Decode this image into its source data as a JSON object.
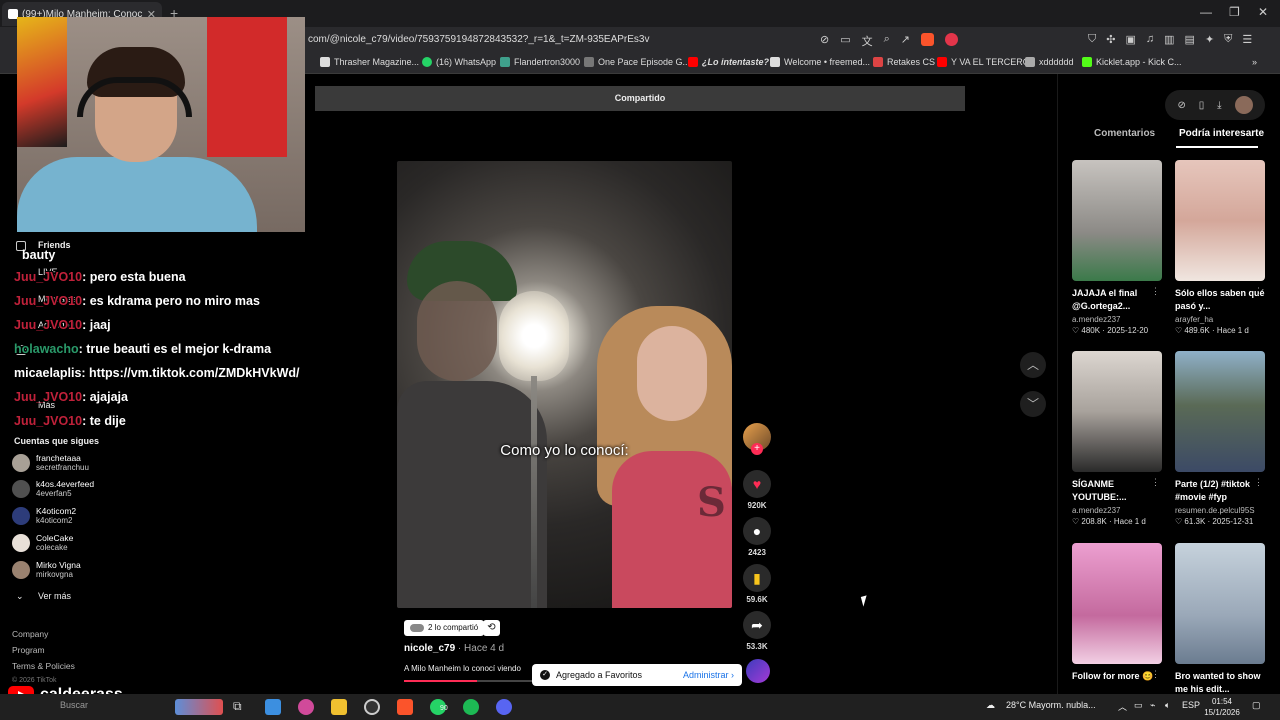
{
  "browser": {
    "tab_title": "(99+)Milo Manheim: Conoci",
    "url": "com/@nicole_c79/video/7593759194872843532?_r=1&_t=ZM-935EAPrEs3v",
    "bookmarks": [
      "Thrasher Magazine...",
      "(16) WhatsApp",
      "Flandertron3000",
      "One Pace Episode G...",
      "¿Lo intentaste?",
      "Welcome • freemed...",
      "Retakes CS",
      "Y VA EL TERCERO",
      "xdddddd",
      "Kicklet.app - Kick C..."
    ]
  },
  "tiktok": {
    "shared_banner": "Compartido",
    "video_caption": "Como yo lo conocí:",
    "actions": {
      "likes": "920K",
      "comments": "2423",
      "saves": "59.6K",
      "shares": "53.3K"
    },
    "shared_pill": "2 lo compartió",
    "creator": "nicole_c79",
    "posted": " · Hace 4 d",
    "description": "A Milo Manheim lo conocí viendo",
    "toast": {
      "text": "Agregado a Favoritos",
      "action": "Administrar"
    },
    "progress": 0.22,
    "side_tabs": [
      "Comentarios",
      "Podría interesarte"
    ],
    "cards": [
      {
        "title": "JAJAJA el final @G.ortega2...",
        "user": "a.mendez237",
        "meta": "♡ 480K · 2025-12-20"
      },
      {
        "title": "Sólo ellos saben qué pasó y...",
        "user": "arayfer_ha",
        "meta": "♡ 489.6K · Hace 1 d"
      },
      {
        "title": "SÍGANME YOUTUBE:...",
        "user": "a.mendez237",
        "meta": "♡ 208.8K · Hace 1 d"
      },
      {
        "title": "Parte (1/2) #tiktok #movie #fyp",
        "user": "resumen.de.pelcul95S",
        "meta": "♡ 61.3K · 2025-12-31"
      },
      {
        "title": "Follow for more 😊",
        "user": "",
        "meta": ""
      },
      {
        "title": "Bro wanted to show me his edit...",
        "user": "",
        "meta": ""
      }
    ]
  },
  "sidebar": {
    "friends": "Friends",
    "live": "LIVE",
    "messages": "Mensajes",
    "activity": "Actividad",
    "more": "Más",
    "following_title": "Cuentas que sigues",
    "following": [
      {
        "name": "franchetaaa",
        "handle": "secretfranchuu"
      },
      {
        "name": "k4os.4everfeed",
        "handle": "4everfan5"
      },
      {
        "name": "K4oticom2",
        "handle": "k4oticom2"
      },
      {
        "name": "ColeCake",
        "handle": "colecake"
      },
      {
        "name": "Mirko Vigna",
        "handle": "mirkovgna"
      }
    ],
    "see_more": "Ver más",
    "footer": [
      "Company",
      "Program",
      "Terms & Policies",
      "© 2026 TikTok"
    ]
  },
  "chat": {
    "header": "bauty",
    "messages": [
      {
        "user": "Juu_JVO10",
        "text": ": pero esta buena"
      },
      {
        "user": "Juu_JVO10",
        "text": ": es kdrama pero no miro mas"
      },
      {
        "user": "Juu_JVO10",
        "text": ": jaaj"
      },
      {
        "user": "holawacho",
        "text": ": true beauti es el mejor k-drama"
      },
      {
        "user": "micaelaplis",
        "text": ": https://vm.tiktok.com/ZMDkHVkWd/"
      },
      {
        "user": "Juu_JVO10",
        "text": ": ajajaja"
      },
      {
        "user": "Juu_JVO10",
        "text": ": te dije"
      }
    ]
  },
  "stream": {
    "channel": "caldeerass"
  },
  "taskbar": {
    "search": "Buscar",
    "weather": "28°C  Mayorm. nubla...",
    "lang": "ESP",
    "time": "01:54",
    "date": "15/1/2026",
    "badge": "90"
  },
  "colors": {
    "tiktok_red": "#fe2c55",
    "save_yellow": "#f8c51c"
  }
}
